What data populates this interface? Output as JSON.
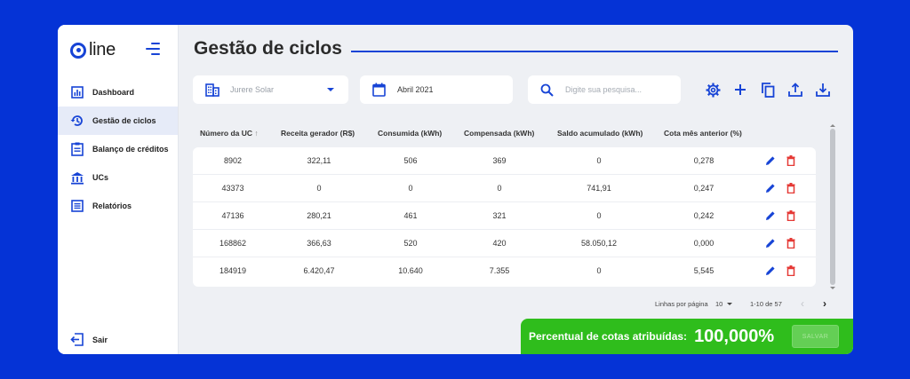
{
  "brand": {
    "logo_text": "line",
    "accent": "#1744d6"
  },
  "sidebar": {
    "items": [
      {
        "label": "Dashboard",
        "icon": "bar-chart-icon"
      },
      {
        "label": "Gestão de ciclos",
        "icon": "history-icon",
        "active": true
      },
      {
        "label": "Balanço de créditos",
        "icon": "clipboard-icon"
      },
      {
        "label": "UCs",
        "icon": "bank-icon"
      },
      {
        "label": "Relatórios",
        "icon": "list-alt-icon"
      }
    ],
    "logout_label": "Sair"
  },
  "header": {
    "title": "Gestão de ciclos"
  },
  "filters": {
    "ucs_value": "Jurere Solar",
    "date_value": "Abril 2021",
    "search_placeholder": "Digite sua pesquisa..."
  },
  "toolbar": [
    "settings-icon",
    "add-icon",
    "copy-icon",
    "upload-icon",
    "download-icon"
  ],
  "table": {
    "columns": [
      "Número da UC",
      "Receita gerador (R$)",
      "Consumida (kWh)",
      "Compensada (kWh)",
      "Saldo acumulado (kWh)",
      "Cota mês anterior (%)"
    ],
    "sort_indicator": "↑",
    "rows": [
      [
        "8902",
        "322,11",
        "506",
        "369",
        "0",
        "0,278"
      ],
      [
        "43373",
        "0",
        "0",
        "0",
        "741,91",
        "0,247"
      ],
      [
        "47136",
        "280,21",
        "461",
        "321",
        "0",
        "0,242"
      ],
      [
        "168862",
        "366,63",
        "520",
        "420",
        "58.050,12",
        "0,000"
      ],
      [
        "184919",
        "6.420,47",
        "10.640",
        "7.355",
        "0",
        "5,545"
      ]
    ]
  },
  "pagination": {
    "rows_per_page_label": "Linhas por página",
    "rows_per_page": "10",
    "range": "1-10 de 57"
  },
  "summary": {
    "label": "Percentual de cotas atribuídas:",
    "value": "100,000%",
    "save_label": "SALVAR",
    "color": "#2fbd1c"
  }
}
